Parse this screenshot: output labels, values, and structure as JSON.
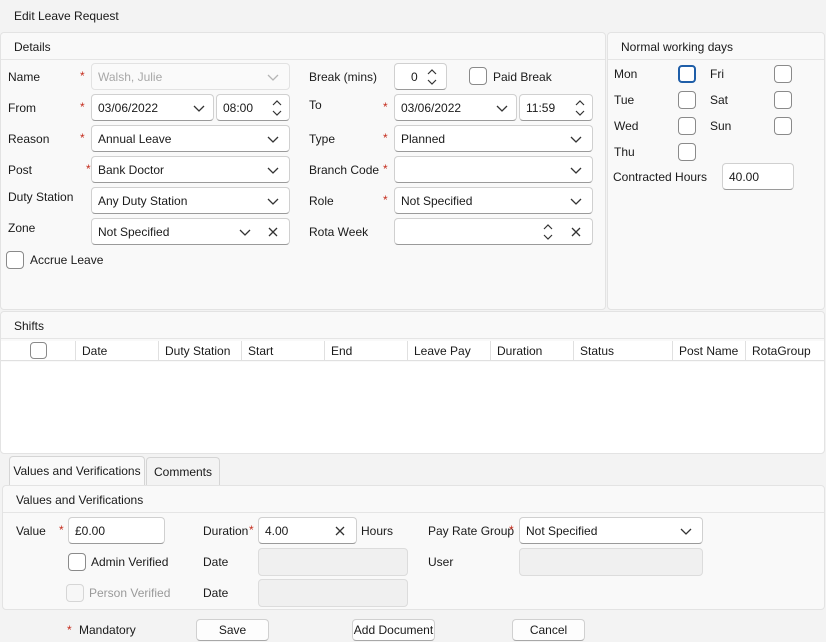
{
  "window": {
    "title": "Edit Leave Request"
  },
  "details": {
    "section_title": "Details",
    "name": {
      "label": "Name",
      "value": "Walsh, Julie"
    },
    "from": {
      "label": "From",
      "date": "03/06/2022",
      "time": "08:00"
    },
    "reason": {
      "label": "Reason",
      "value": "Annual Leave"
    },
    "post": {
      "label": "Post",
      "value": "Bank Doctor"
    },
    "duty_station": {
      "label": "Duty Station",
      "value": "Any Duty Station"
    },
    "zone": {
      "label": "Zone",
      "value": "Not Specified"
    },
    "accrue_leave": {
      "label": "Accrue Leave",
      "checked": false
    },
    "break": {
      "label": "Break (mins)",
      "value": "0"
    },
    "paid_break": {
      "label": "Paid Break",
      "checked": false
    },
    "to": {
      "label": "To",
      "date": "03/06/2022",
      "time": "11:59"
    },
    "type": {
      "label": "Type",
      "value": "Planned"
    },
    "branch_code": {
      "label": "Branch Code",
      "value": ""
    },
    "role": {
      "label": "Role",
      "value": "Not Specified"
    },
    "rota_week": {
      "label": "Rota Week",
      "value": ""
    },
    "required_marker": "*"
  },
  "working_days": {
    "section_title": "Normal working days",
    "days": {
      "mon": "Mon",
      "tue": "Tue",
      "wed": "Wed",
      "thu": "Thu",
      "fri": "Fri",
      "sat": "Sat",
      "sun": "Sun"
    },
    "contracted_hours": {
      "label": "Contracted Hours",
      "value": "40.00"
    }
  },
  "shifts": {
    "section_title": "Shifts",
    "columns": [
      "Date",
      "Duty Station",
      "Start",
      "End",
      "Leave Pay",
      "Duration",
      "Status",
      "Post Name",
      "RotaGroup"
    ]
  },
  "tabs": {
    "values": "Values and Verifications",
    "comments": "Comments"
  },
  "values": {
    "section_title": "Values and Verifications",
    "value": {
      "label": "Value",
      "value": "£0.00"
    },
    "duration": {
      "label": "Duration",
      "value": "4.00",
      "unit": "Hours"
    },
    "pay_rate_group": {
      "label": "Pay Rate Group",
      "value": "Not Specified"
    },
    "admin_verified": {
      "label": "Admin Verified",
      "checked": false
    },
    "person_verified": {
      "label": "Person Verified",
      "checked": false
    },
    "date_label_1": "Date",
    "date_label_2": "Date",
    "user_label": "User"
  },
  "footer": {
    "mandatory": "Mandatory",
    "save": "Save",
    "add_document": "Add Document",
    "cancel": "Cancel"
  },
  "colors": {
    "accent": "#1f5ea8",
    "required": "#c42b1c"
  },
  "icons": {
    "dropdown": "chevron-down-icon",
    "clear": "close-icon",
    "spinner": "spinner-icon"
  }
}
